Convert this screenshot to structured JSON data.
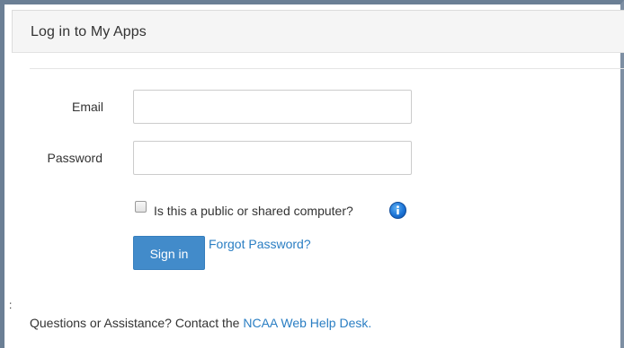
{
  "panel": {
    "title": "Log in to My Apps"
  },
  "form": {
    "email_label": "Email",
    "email_value": "",
    "password_label": "Password",
    "password_value": "",
    "public_computer_label": "Is this a public or shared computer?",
    "public_computer_checked": false,
    "info_icon": "info-icon",
    "signin_label": "Sign in",
    "forgot_password_label": "Forgot Password?"
  },
  "footer": {
    "stray_mark": ":",
    "text": "Questions or Assistance? Contact the ",
    "link_label": "NCAA Web Help Desk."
  },
  "colors": {
    "accent": "#428bca",
    "link": "#2a7ec3",
    "frame": "#6b7f95",
    "header_bg": "#f5f5f5"
  }
}
